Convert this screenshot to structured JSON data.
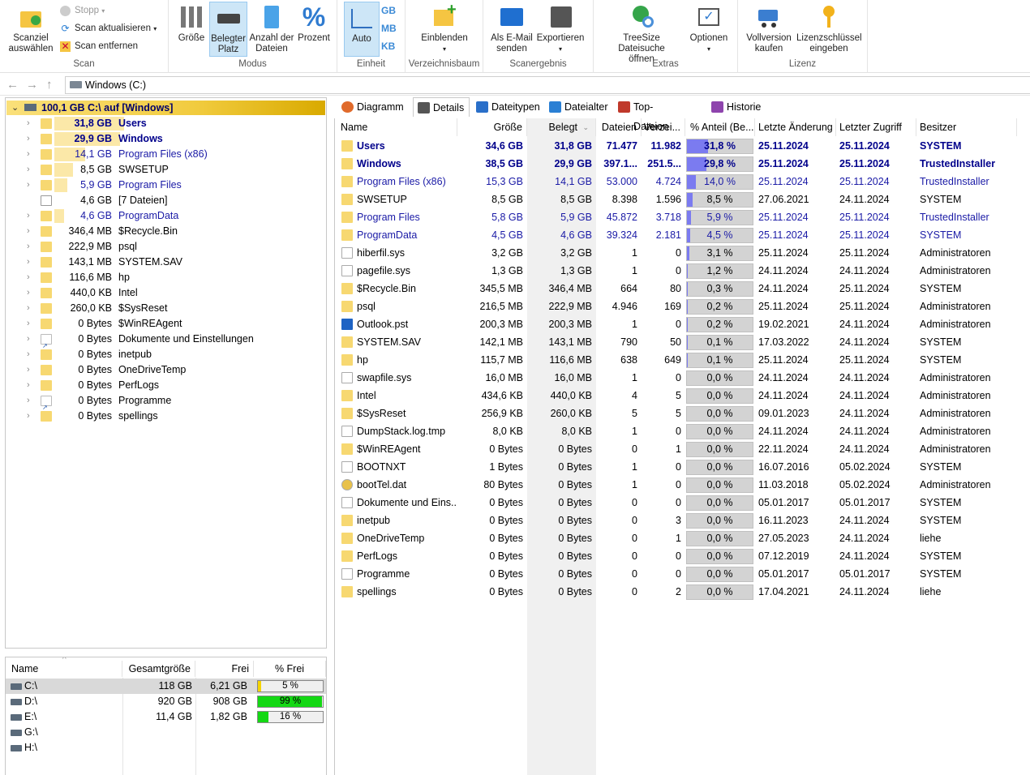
{
  "ribbon": {
    "scan_group": "Scan",
    "scan_target": "Scanziel\nauswählen",
    "stop": "Stopp",
    "refresh": "Scan aktualisieren",
    "remove": "Scan entfernen",
    "modus_group": "Modus",
    "size": "Größe",
    "used": "Belegter\nPlatz",
    "count": "Anzahl der\nDateien",
    "percent": "Prozent",
    "unit_group": "Einheit",
    "auto": "Auto",
    "gb": "GB",
    "mb": "MB",
    "kb": "KB",
    "tree_group": "Verzeichnisbaum",
    "show": "Einblenden",
    "result_group": "Scanergebnis",
    "email": "Als E-Mail\nsenden",
    "export": "Exportieren",
    "extras_group": "Extras",
    "search": "TreeSize Dateisuche\nöffnen",
    "options": "Optionen",
    "license_group": "Lizenz",
    "buy": "Vollversion\nkaufen",
    "key": "Lizenzschlüssel\neingeben"
  },
  "address": {
    "path": "Windows (C:)"
  },
  "root": {
    "label": "100,1 GB  C:\\  auf  [Windows]"
  },
  "tree": [
    {
      "size": "31,8 GB",
      "name": "Users",
      "style": "bd",
      "bar": 0.32,
      "icon": "folder"
    },
    {
      "size": "29,9 GB",
      "name": "Windows",
      "style": "bd",
      "bar": 0.3,
      "icon": "folder"
    },
    {
      "size": "14,1 GB",
      "name": "Program Files (x86)",
      "style": "bl",
      "bar": 0.14,
      "icon": "folder"
    },
    {
      "size": "8,5 GB",
      "name": "SWSETUP",
      "style": "",
      "bar": 0.085,
      "icon": "folder"
    },
    {
      "size": "5,9 GB",
      "name": "Program Files",
      "style": "bl",
      "bar": 0.059,
      "icon": "folder"
    },
    {
      "size": "4,6 GB",
      "name": "[7 Dateien]",
      "style": "",
      "bar": 0,
      "icon": "doc"
    },
    {
      "size": "4,6 GB",
      "name": "ProgramData",
      "style": "bl",
      "bar": 0.046,
      "icon": "folder"
    },
    {
      "size": "346,4 MB",
      "name": "$Recycle.Bin",
      "style": "",
      "bar": 0,
      "icon": "folder"
    },
    {
      "size": "222,9 MB",
      "name": "psql",
      "style": "",
      "bar": 0,
      "icon": "folder"
    },
    {
      "size": "143,1 MB",
      "name": "SYSTEM.SAV",
      "style": "",
      "bar": 0,
      "icon": "folder"
    },
    {
      "size": "116,6 MB",
      "name": "hp",
      "style": "",
      "bar": 0,
      "icon": "folder"
    },
    {
      "size": "440,0 KB",
      "name": "Intel",
      "style": "",
      "bar": 0,
      "icon": "folder"
    },
    {
      "size": "260,0 KB",
      "name": "$SysReset",
      "style": "",
      "bar": 0,
      "icon": "folder"
    },
    {
      "size": "0 Bytes",
      "name": "$WinREAgent",
      "style": "",
      "bar": 0,
      "icon": "folder"
    },
    {
      "size": "0 Bytes",
      "name": "Dokumente und Einstellungen",
      "style": "",
      "bar": 0,
      "icon": "link"
    },
    {
      "size": "0 Bytes",
      "name": "inetpub",
      "style": "",
      "bar": 0,
      "icon": "folder"
    },
    {
      "size": "0 Bytes",
      "name": "OneDriveTemp",
      "style": "",
      "bar": 0,
      "icon": "folder"
    },
    {
      "size": "0 Bytes",
      "name": "PerfLogs",
      "style": "",
      "bar": 0,
      "icon": "folder"
    },
    {
      "size": "0 Bytes",
      "name": "Programme",
      "style": "",
      "bar": 0,
      "icon": "link"
    },
    {
      "size": "0 Bytes",
      "name": "spellings",
      "style": "",
      "bar": 0,
      "icon": "folder"
    }
  ],
  "drives": {
    "headers": [
      "Name",
      "Gesamtgröße",
      "Frei",
      "% Frei"
    ],
    "rows": [
      {
        "name": "C:\\",
        "total": "118 GB",
        "free": "6,21 GB",
        "pct": "5 %",
        "frac": 0.05,
        "color": "#f5d400"
      },
      {
        "name": "D:\\",
        "total": "920 GB",
        "free": "908 GB",
        "pct": "99 %",
        "frac": 0.99,
        "color": "#14d814"
      },
      {
        "name": "E:\\",
        "total": "11,4 GB",
        "free": "1,82 GB",
        "pct": "16 %",
        "frac": 0.16,
        "color": "#14d814"
      },
      {
        "name": "G:\\",
        "total": "",
        "free": "",
        "pct": "",
        "frac": 0,
        "color": ""
      },
      {
        "name": "H:\\",
        "total": "",
        "free": "",
        "pct": "",
        "frac": 0,
        "color": ""
      }
    ]
  },
  "tabs": [
    "Diagramm",
    "Details",
    "Dateitypen",
    "Dateialter",
    "Top-Dateien",
    "Historie"
  ],
  "columns": [
    "Name",
    "Größe",
    "Belegt",
    "Dateien",
    "Verzei...",
    "% Anteil (Be...",
    "Letzte Änderung",
    "Letzter Zugriff",
    "Besitzer"
  ],
  "rows": [
    {
      "name": "Users",
      "size": "34,6 GB",
      "used": "31,8 GB",
      "files": "71.477",
      "dirs": "11.982",
      "pct": "31,8 %",
      "frac": 0.318,
      "mod": "25.11.2024",
      "acc": "25.11.2024",
      "owner": "SYSTEM",
      "style": "bd",
      "icon": "folder"
    },
    {
      "name": "Windows",
      "size": "38,5 GB",
      "used": "29,9 GB",
      "files": "397.1...",
      "dirs": "251.5...",
      "pct": "29,8 %",
      "frac": 0.298,
      "mod": "25.11.2024",
      "acc": "25.11.2024",
      "owner": "TrustedInstaller",
      "style": "bd",
      "icon": "folder"
    },
    {
      "name": "Program Files (x86)",
      "size": "15,3 GB",
      "used": "14,1 GB",
      "files": "53.000",
      "dirs": "4.724",
      "pct": "14,0 %",
      "frac": 0.14,
      "mod": "25.11.2024",
      "acc": "25.11.2024",
      "owner": "TrustedInstaller",
      "style": "bl",
      "icon": "folder"
    },
    {
      "name": "SWSETUP",
      "size": "8,5 GB",
      "used": "8,5 GB",
      "files": "8.398",
      "dirs": "1.596",
      "pct": "8,5 %",
      "frac": 0.085,
      "mod": "27.06.2021",
      "acc": "24.11.2024",
      "owner": "SYSTEM",
      "style": "",
      "icon": "folder"
    },
    {
      "name": "Program Files",
      "size": "5,8 GB",
      "used": "5,9 GB",
      "files": "45.872",
      "dirs": "3.718",
      "pct": "5,9 %",
      "frac": 0.059,
      "mod": "25.11.2024",
      "acc": "25.11.2024",
      "owner": "TrustedInstaller",
      "style": "bl",
      "icon": "folder"
    },
    {
      "name": "ProgramData",
      "size": "4,5 GB",
      "used": "4,6 GB",
      "files": "39.324",
      "dirs": "2.181",
      "pct": "4,5 %",
      "frac": 0.045,
      "mod": "25.11.2024",
      "acc": "25.11.2024",
      "owner": "SYSTEM",
      "style": "bl",
      "icon": "folder"
    },
    {
      "name": "hiberfil.sys",
      "size": "3,2 GB",
      "used": "3,2 GB",
      "files": "1",
      "dirs": "0",
      "pct": "3,1 %",
      "frac": 0.031,
      "mod": "25.11.2024",
      "acc": "25.11.2024",
      "owner": "Administratoren",
      "style": "",
      "icon": "file"
    },
    {
      "name": "pagefile.sys",
      "size": "1,3 GB",
      "used": "1,3 GB",
      "files": "1",
      "dirs": "0",
      "pct": "1,2 %",
      "frac": 0.012,
      "mod": "24.11.2024",
      "acc": "24.11.2024",
      "owner": "Administratoren",
      "style": "",
      "icon": "file"
    },
    {
      "name": "$Recycle.Bin",
      "size": "345,5 MB",
      "used": "346,4 MB",
      "files": "664",
      "dirs": "80",
      "pct": "0,3 %",
      "frac": 0.003,
      "mod": "24.11.2024",
      "acc": "25.11.2024",
      "owner": "SYSTEM",
      "style": "",
      "icon": "folder"
    },
    {
      "name": "psql",
      "size": "216,5 MB",
      "used": "222,9 MB",
      "files": "4.946",
      "dirs": "169",
      "pct": "0,2 %",
      "frac": 0.002,
      "mod": "25.11.2024",
      "acc": "25.11.2024",
      "owner": "Administratoren",
      "style": "",
      "icon": "folder"
    },
    {
      "name": "Outlook.pst",
      "size": "200,3 MB",
      "used": "200,3 MB",
      "files": "1",
      "dirs": "0",
      "pct": "0,2 %",
      "frac": 0.002,
      "mod": "19.02.2021",
      "acc": "24.11.2024",
      "owner": "Administratoren",
      "style": "",
      "icon": "outlook"
    },
    {
      "name": "SYSTEM.SAV",
      "size": "142,1 MB",
      "used": "143,1 MB",
      "files": "790",
      "dirs": "50",
      "pct": "0,1 %",
      "frac": 0.001,
      "mod": "17.03.2022",
      "acc": "24.11.2024",
      "owner": "SYSTEM",
      "style": "",
      "icon": "folder"
    },
    {
      "name": "hp",
      "size": "115,7 MB",
      "used": "116,6 MB",
      "files": "638",
      "dirs": "649",
      "pct": "0,1 %",
      "frac": 0.001,
      "mod": "25.11.2024",
      "acc": "25.11.2024",
      "owner": "SYSTEM",
      "style": "",
      "icon": "folder"
    },
    {
      "name": "swapfile.sys",
      "size": "16,0 MB",
      "used": "16,0 MB",
      "files": "1",
      "dirs": "0",
      "pct": "0,0 %",
      "frac": 0,
      "mod": "24.11.2024",
      "acc": "24.11.2024",
      "owner": "Administratoren",
      "style": "",
      "icon": "file"
    },
    {
      "name": "Intel",
      "size": "434,6 KB",
      "used": "440,0 KB",
      "files": "4",
      "dirs": "5",
      "pct": "0,0 %",
      "frac": 0,
      "mod": "24.11.2024",
      "acc": "24.11.2024",
      "owner": "Administratoren",
      "style": "",
      "icon": "folder"
    },
    {
      "name": "$SysReset",
      "size": "256,9 KB",
      "used": "260,0 KB",
      "files": "5",
      "dirs": "5",
      "pct": "0,0 %",
      "frac": 0,
      "mod": "09.01.2023",
      "acc": "24.11.2024",
      "owner": "Administratoren",
      "style": "",
      "icon": "folder"
    },
    {
      "name": "DumpStack.log.tmp",
      "size": "8,0 KB",
      "used": "8,0 KB",
      "files": "1",
      "dirs": "0",
      "pct": "0,0 %",
      "frac": 0,
      "mod": "24.11.2024",
      "acc": "24.11.2024",
      "owner": "Administratoren",
      "style": "",
      "icon": "file"
    },
    {
      "name": "$WinREAgent",
      "size": "0 Bytes",
      "used": "0 Bytes",
      "files": "0",
      "dirs": "1",
      "pct": "0,0 %",
      "frac": 0,
      "mod": "22.11.2024",
      "acc": "24.11.2024",
      "owner": "Administratoren",
      "style": "",
      "icon": "folder"
    },
    {
      "name": "BOOTNXT",
      "size": "1 Bytes",
      "used": "0 Bytes",
      "files": "1",
      "dirs": "0",
      "pct": "0,0 %",
      "frac": 0,
      "mod": "16.07.2016",
      "acc": "05.02.2024",
      "owner": "SYSTEM",
      "style": "",
      "icon": "file"
    },
    {
      "name": "bootTel.dat",
      "size": "80 Bytes",
      "used": "0 Bytes",
      "files": "1",
      "dirs": "0",
      "pct": "0,0 %",
      "frac": 0,
      "mod": "11.03.2018",
      "acc": "05.02.2024",
      "owner": "Administratoren",
      "style": "",
      "icon": "disc"
    },
    {
      "name": "Dokumente und Eins...",
      "size": "0 Bytes",
      "used": "0 Bytes",
      "files": "0",
      "dirs": "0",
      "pct": "0,0 %",
      "frac": 0,
      "mod": "05.01.2017",
      "acc": "05.01.2017",
      "owner": "SYSTEM",
      "style": "",
      "icon": "link"
    },
    {
      "name": "inetpub",
      "size": "0 Bytes",
      "used": "0 Bytes",
      "files": "0",
      "dirs": "3",
      "pct": "0,0 %",
      "frac": 0,
      "mod": "16.11.2023",
      "acc": "24.11.2024",
      "owner": "SYSTEM",
      "style": "",
      "icon": "folder"
    },
    {
      "name": "OneDriveTemp",
      "size": "0 Bytes",
      "used": "0 Bytes",
      "files": "0",
      "dirs": "1",
      "pct": "0,0 %",
      "frac": 0,
      "mod": "27.05.2023",
      "acc": "24.11.2024",
      "owner": "liehe",
      "style": "",
      "icon": "folder"
    },
    {
      "name": "PerfLogs",
      "size": "0 Bytes",
      "used": "0 Bytes",
      "files": "0",
      "dirs": "0",
      "pct": "0,0 %",
      "frac": 0,
      "mod": "07.12.2019",
      "acc": "24.11.2024",
      "owner": "SYSTEM",
      "style": "",
      "icon": "folder"
    },
    {
      "name": "Programme",
      "size": "0 Bytes",
      "used": "0 Bytes",
      "files": "0",
      "dirs": "0",
      "pct": "0,0 %",
      "frac": 0,
      "mod": "05.01.2017",
      "acc": "05.01.2017",
      "owner": "SYSTEM",
      "style": "",
      "icon": "link"
    },
    {
      "name": "spellings",
      "size": "0 Bytes",
      "used": "0 Bytes",
      "files": "0",
      "dirs": "2",
      "pct": "0,0 %",
      "frac": 0,
      "mod": "17.04.2021",
      "acc": "24.11.2024",
      "owner": "liehe",
      "style": "",
      "icon": "folder"
    }
  ]
}
